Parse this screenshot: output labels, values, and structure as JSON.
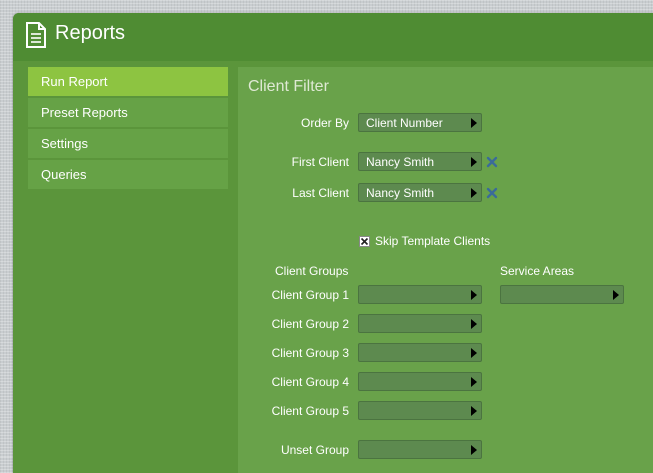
{
  "window": {
    "title": "Reports",
    "icon": "document-icon"
  },
  "nav": {
    "items": [
      {
        "label": "Run Report",
        "active": true
      },
      {
        "label": "Preset Reports",
        "active": false
      },
      {
        "label": "Settings",
        "active": false
      },
      {
        "label": "Queries",
        "active": false
      }
    ]
  },
  "panel": {
    "title": "Client Filter",
    "order_by": {
      "label": "Order By",
      "value": "Client Number"
    },
    "first_client": {
      "label": "First Client",
      "value": "Nancy Smith"
    },
    "last_client": {
      "label": "Last Client",
      "value": "Nancy Smith"
    },
    "skip_template": {
      "label": "Skip Template Clients",
      "checked": true
    },
    "client_groups_header": "Client Groups",
    "service_areas_header": "Service Areas",
    "client_groups": [
      {
        "label": "Client Group 1",
        "value": ""
      },
      {
        "label": "Client Group 2",
        "value": ""
      },
      {
        "label": "Client Group 3",
        "value": ""
      },
      {
        "label": "Client Group 4",
        "value": ""
      },
      {
        "label": "Client Group 5",
        "value": ""
      }
    ],
    "service_area": {
      "value": ""
    },
    "unset_group": {
      "label": "Unset Group",
      "value": ""
    }
  },
  "colors": {
    "window_bg": "#5b953b",
    "panel_bg": "#69a24a",
    "nav_active": "#8dc441",
    "nav_item": "#66a246",
    "clear_icon": "#3a6b9a"
  }
}
